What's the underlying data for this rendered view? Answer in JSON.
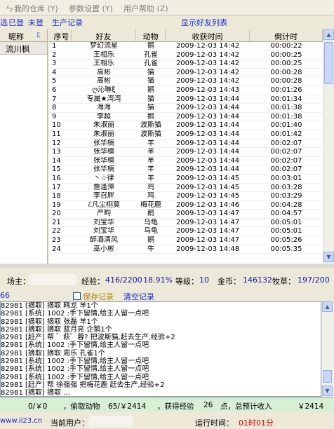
{
  "menu": {
    "items": [
      "我的仓库 (Y)",
      "参数设置 (Y)",
      "用户帮助 (Z)"
    ]
  },
  "toolbar": {
    "filters": [
      "选",
      "已登",
      "未登"
    ],
    "production_records": "生产记录",
    "friends_list_title": "显示好友列表"
  },
  "left_panel": {
    "header": "昵称",
    "selected": "流川枫"
  },
  "grid": {
    "headers": [
      "序号",
      "好友",
      "动物",
      "收获时间",
      "倒计时"
    ],
    "rows": [
      [
        "1",
        "梦幻流星",
        "鹅",
        "2009-12-03 14:42",
        "00:00:22"
      ],
      [
        "2",
        "王相乐",
        "孔雀",
        "2009-12-03 14:42",
        "00:00:25"
      ],
      [
        "3",
        "王相乐",
        "孔雀",
        "2009-12-03 14:42",
        "00:00:25"
      ],
      [
        "4",
        "高彬",
        "猫",
        "2009-12-03 14:42",
        "00:00:28"
      ],
      [
        "5",
        "高彬",
        "猫",
        "2009-12-03 14:42",
        "00:00:28"
      ],
      [
        "6",
        "ღ沁琳ξ",
        "鹅",
        "2009-12-03 14:43",
        "00:01:26"
      ],
      [
        "7",
        "专属★湾湾",
        "猫",
        "2009-12-03 14:44",
        "00:01:34"
      ],
      [
        "8",
        "海海",
        "猫",
        "2009-12-03 14:44",
        "00:01:38"
      ],
      [
        "9",
        "李超",
        "鹅",
        "2009-12-03 14:44",
        "00:01:38"
      ],
      [
        "10",
        "朱淑丽",
        "波斯猫",
        "2009-12-03 14:44",
        "00:01:40"
      ],
      [
        "11",
        "朱淑丽",
        "波斯猫",
        "2009-12-03 14:44",
        "00:01:42"
      ],
      [
        "12",
        "张华楠",
        "羊",
        "2009-12-03 14:44",
        "00:02:07"
      ],
      [
        "13",
        "张华楠",
        "羊",
        "2009-12-03 14:44",
        "00:02:07"
      ],
      [
        "14",
        "张华楠",
        "羊",
        "2009-12-03 14:44",
        "00:02:07"
      ],
      [
        "15",
        "张华楠",
        "羊",
        "2009-12-03 14:44",
        "00:02:07"
      ],
      [
        "16",
        "丶☆律",
        "羊",
        "2009-12-03 14:45",
        "00:03:01"
      ],
      [
        "17",
        "詹逢萍",
        "鸡",
        "2009-12-03 14:45",
        "00:03:28"
      ],
      [
        "18",
        "李召胖",
        "鸡",
        "2009-12-03 14:45",
        "00:03:29"
      ],
      [
        "19",
        "ℰ凡尘栩莫",
        "梅花鹿",
        "2009-12-03 14:46",
        "00:04:28"
      ],
      [
        "20",
        "严畇",
        "鹅",
        "2009-12-03 14:47",
        "00:04:57"
      ],
      [
        "21",
        "刘宝华",
        "乌龟",
        "2009-12-03 14:47",
        "00:05:01"
      ],
      [
        "22",
        "刘宝华",
        "乌龟",
        "2009-12-03 14:47",
        "00:05:01"
      ],
      [
        "23",
        "醉酒清风",
        "鹅",
        "2009-12-03 14:47",
        "00:05:26"
      ],
      [
        "24",
        "巫小彬",
        "牛",
        "2009-12-03 14:48",
        "00:05:35"
      ]
    ]
  },
  "status": {
    "owner_label": "场主：",
    "exp_label": "经验：",
    "exp_value": "416/2200",
    "exp_pct": "18.91%",
    "level_label": "等级：",
    "level_value": "10",
    "gold_label": "金币：",
    "gold_value": "146132",
    "pasture_label": "牧草：",
    "pasture_value": "197/200"
  },
  "log_toolbar": {
    "left_num": "66",
    "save_label": "保存记录",
    "clear_label": "清空记录"
  },
  "log_lines": [
    "82981 [摘取] 摘取 韩龙 羊1个",
    "82981 [系统] 1002 :手下留情,给主人留一点吧",
    "82981 [摘取] 摘取 张磊 羊1个",
    "82981 [摘取] 摘取 蓝月亮 企鹅1个",
    "82981 [赶产] 帮 ゛萩゛蓉? 把波斯猫,赶去生产,经验+2",
    "82981 [系统] 1002 :手下留情,给主人留一点吧",
    "82981 [摘取] 摘取 周乐 孔雀1个",
    "82981 [系统] 1002 :手下留情,给主人留一点吧",
    "82981 [系统] 1002 :手下留情,给主人留一点吧",
    "82981 [系统] 1002 :手下留情,给主人留一点吧",
    "82981 [赶产] 帮 徐强强 把梅花鹿 赶去生产,经验+2",
    "82981 [摘取] 摘取 ..."
  ],
  "stats": {
    "a": "0/￥0",
    "b": "，偷取动物",
    "c": "65/￥2414",
    "d": "，获得经验",
    "e": "26",
    "f": "点，总预计收入",
    "g": "￥2414"
  },
  "footer": {
    "site": "www.ii23.cn",
    "current_user_label": "当前用户：",
    "runtime_label": "运行时间：",
    "runtime_value": "01时01分"
  },
  "colors": {
    "link": "#1b2bd1",
    "green_panel": "#d7efd5",
    "runtime": "#e00000",
    "save_record": "#b8860b"
  }
}
